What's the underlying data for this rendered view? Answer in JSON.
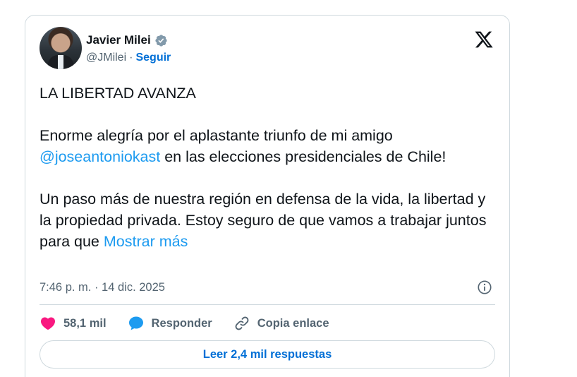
{
  "author": {
    "name": "Javier Milei",
    "handle": "@JMilei",
    "separator": "·",
    "follow_label": "Seguir"
  },
  "tweet": {
    "line1": "LA LIBERTAD AVANZA",
    "para2_before": "Enorme alegría por el aplastante triunfo de mi amigo ",
    "mention": "@joseantoniokast",
    "para2_after": " en las elecciones presidenciales de Chile!",
    "para3": "Un paso más de nuestra región en defensa de la vida, la libertad y la propiedad privada. Estoy seguro de que vamos a trabajar juntos para que ",
    "show_more": "Mostrar más"
  },
  "timestamp": "7:46 p. m. · 14 dic. 2025",
  "actions": {
    "likes": "58,1 mil",
    "reply_label": "Responder",
    "copy_link_label": "Copia enlace"
  },
  "replies_button": "Leer 2,4 mil respuestas",
  "icons": {
    "verified": "verified-badge-icon",
    "x_logo": "x-logo-icon",
    "info": "info-icon",
    "heart": "heart-icon",
    "reply": "reply-bubble-icon",
    "link": "link-icon"
  },
  "colors": {
    "accent": "#1d9bf0",
    "link_blue": "#006fd6",
    "heart": "#f91880",
    "muted": "#536471",
    "border": "#cfd9de"
  }
}
